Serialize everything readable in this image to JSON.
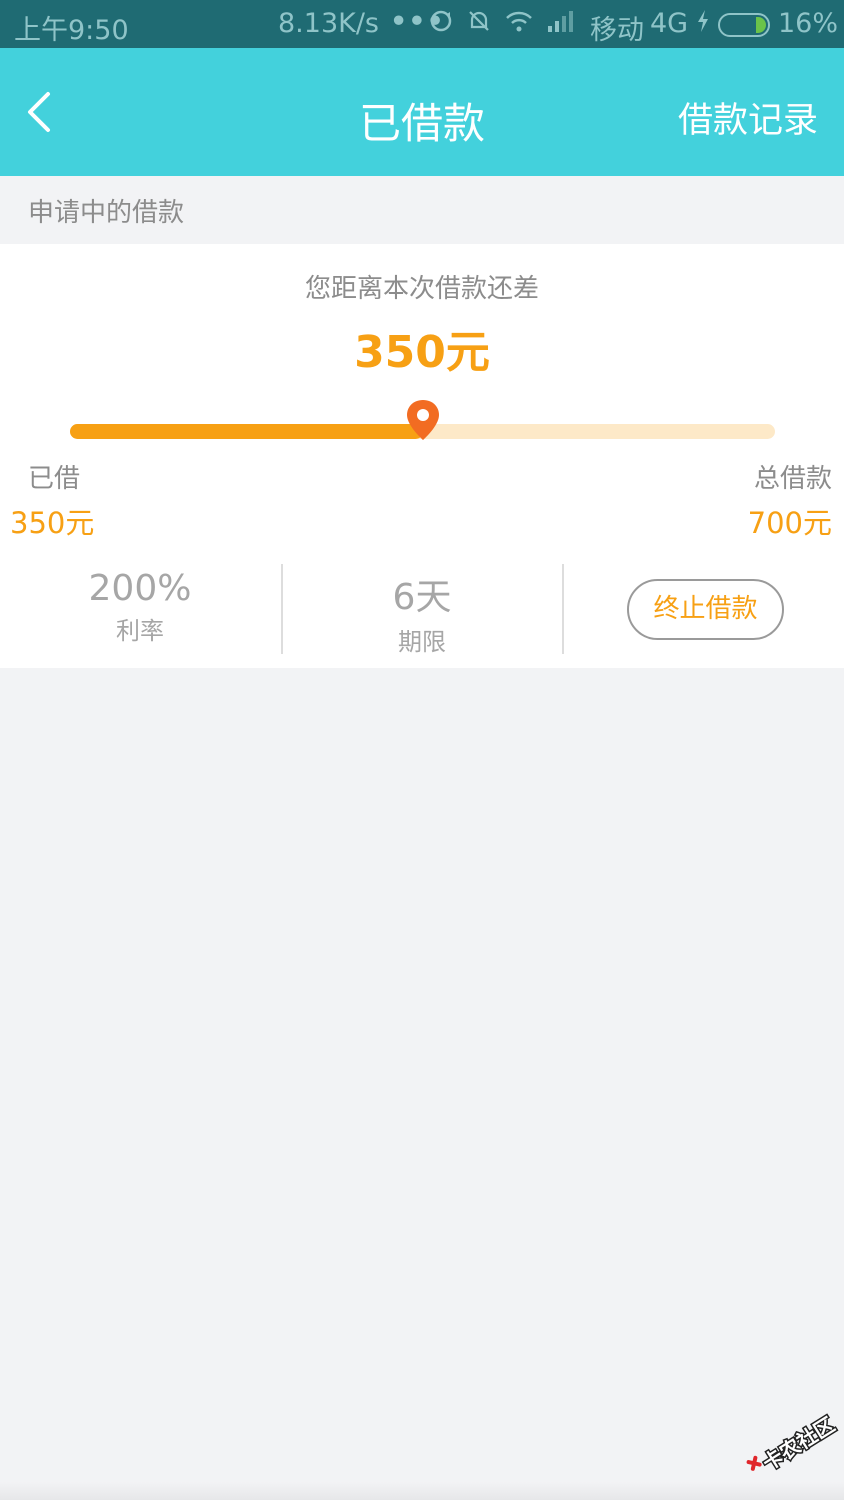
{
  "status_bar": {
    "time": "上午9:50",
    "speed": "8.13K/s",
    "dots": "•••",
    "carrier": "移动",
    "network": "4G",
    "battery": "16%",
    "icons": [
      "sync-icon",
      "mute-bell-icon",
      "wifi-icon",
      "signal-icon",
      "charging-icon",
      "battery-icon"
    ]
  },
  "nav": {
    "back_icon": "chevron-left-icon",
    "title": "已借款",
    "action": "借款记录"
  },
  "section": {
    "label": "申请中的借款"
  },
  "progress_card": {
    "gap_label": "您距离本次借款还差",
    "gap_amount": "350元",
    "progress_fraction": 0.5,
    "borrowed_label": "已借",
    "borrowed_value": "350元",
    "total_label": "总借款",
    "total_value": "700元"
  },
  "stats": {
    "rate_value": "200%",
    "rate_label": "利率",
    "term_value": "6天",
    "term_label": "期限",
    "stop_button": "终止借款"
  },
  "colors": {
    "header": "#43d1dc",
    "accent": "#f7a014",
    "marker": "#f26c22",
    "track_bg": "#fde9c8",
    "page_bg": "#f2f3f5"
  },
  "watermark": {
    "text": "卡农社区"
  }
}
